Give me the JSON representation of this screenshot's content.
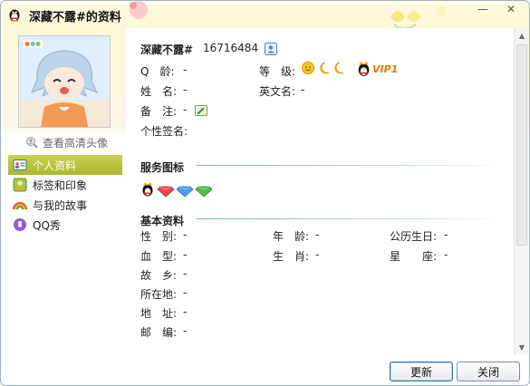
{
  "window": {
    "title": "深藏不露#的资料",
    "minimize_glyph": "—",
    "close_glyph": "✕"
  },
  "left": {
    "view_hd_label": "查看高清头像",
    "nav": [
      {
        "label": "个人资料",
        "icon": "id-card-icon",
        "active": true
      },
      {
        "label": "标签和印象",
        "icon": "tag-avatar-icon",
        "active": false
      },
      {
        "label": "与我的故事",
        "icon": "rainbow-icon",
        "active": false
      },
      {
        "label": "QQ秀",
        "icon": "qq-show-icon",
        "active": false
      }
    ]
  },
  "profile": {
    "nickname": "深藏不露#",
    "qq_number": "16716484",
    "fields": {
      "qq_age": {
        "label": "Q　龄:",
        "value": "-"
      },
      "level": {
        "label": "等　级:"
      },
      "name": {
        "label": "姓　名:",
        "value": "-"
      },
      "english_name": {
        "label": "英文名:",
        "value": "-"
      },
      "remark": {
        "label": "备　注:",
        "value": "-"
      },
      "signature": {
        "label": "个性签名:"
      }
    },
    "vip_text": "VIP1"
  },
  "sections": {
    "service_icons": "服务图标",
    "basic_info": "基本资料"
  },
  "basic": {
    "row1": [
      {
        "label": "性　别:",
        "value": "-"
      },
      {
        "label": "年　龄:",
        "value": "-"
      },
      {
        "label": "公历生日:",
        "value": "-"
      }
    ],
    "row2": [
      {
        "label": "血　型:",
        "value": "-"
      },
      {
        "label": "生　肖:",
        "value": "-"
      },
      {
        "label": "星　　座:",
        "value": "-"
      }
    ],
    "hometown": {
      "label": "故　乡:",
      "value": "-"
    },
    "location": {
      "label": "所在地:",
      "value": "-"
    },
    "address": {
      "label": "地　址:",
      "value": "-"
    },
    "postcode": {
      "label": "邮　编:",
      "value": "-"
    }
  },
  "buttons": {
    "refresh": "更新",
    "close": "关闭"
  },
  "colors": {
    "active_nav": "#b3c23a",
    "section_line": "#7ea9d1",
    "title_bg": "#fff8d8",
    "vip_orange": "#e37a00"
  }
}
